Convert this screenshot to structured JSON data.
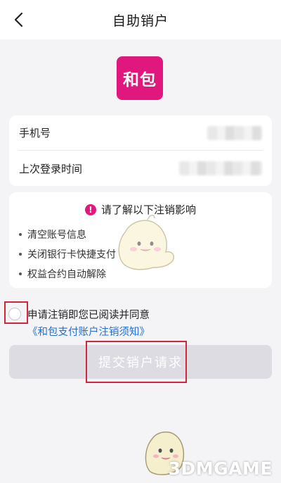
{
  "header": {
    "title": "自助销户",
    "back_icon": "chevron-left-icon"
  },
  "logo": {
    "text": "和包",
    "color": "#e0187d"
  },
  "account_info": {
    "phone_label": "手机号",
    "last_login_label": "上次登录时间"
  },
  "notice": {
    "icon_text": "!",
    "title": "请了解以下注销影响",
    "items": [
      "清空账号信息",
      "关闭银行卡快捷支付",
      "权益合约自动解除"
    ]
  },
  "agreement": {
    "text": "申请注销即您已阅读并同意",
    "link": "《和包支付账户注销须知》",
    "checked": false
  },
  "submit": {
    "label": "提交销户请求",
    "enabled": false
  },
  "colors": {
    "accent": "#e0187d",
    "link": "#1f6fd6",
    "annotation": "#d0273c",
    "disabled_button": "#dcdce2"
  },
  "watermark": {
    "text": "3DMGAME"
  }
}
